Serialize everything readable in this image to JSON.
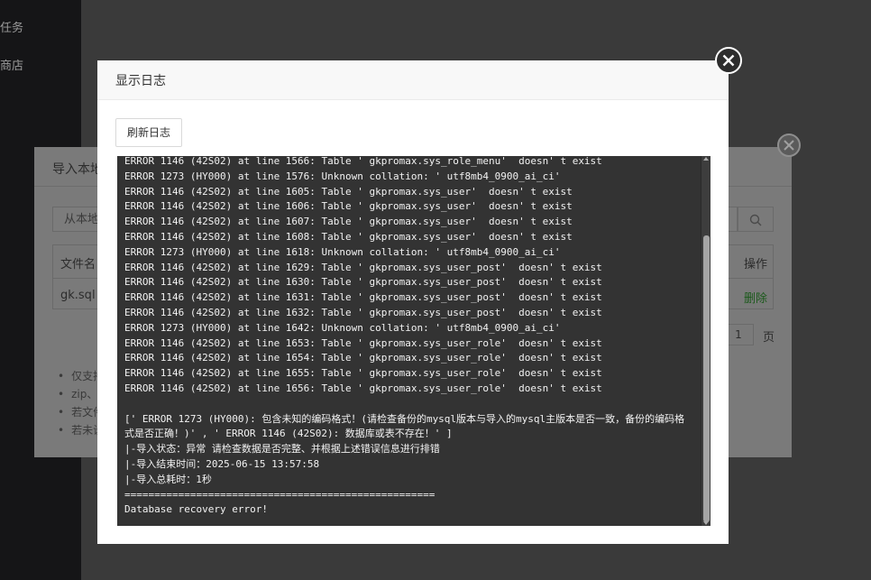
{
  "sidebar": {
    "items": [
      {
        "label": "任务"
      },
      {
        "label": "商店"
      }
    ]
  },
  "import_dialog": {
    "title": "导入本地",
    "upload_placeholder": "从本地",
    "columns": {
      "file_name": "文件名",
      "action": "操作"
    },
    "rows": [
      {
        "file_name": "gk.sql",
        "delete_label": "删除"
      }
    ],
    "page_value": "1",
    "page_unit": "页",
    "tips": [
      "仅支持",
      "zip、",
      "若文件",
      "若未设"
    ]
  },
  "log_modal": {
    "title": "显示日志",
    "refresh_label": "刷新日志",
    "lines": [
      "ERROR 1146 (42S02) at line 1566: Table ' gkpromax.sys_role_menu'  doesn' t exist",
      "ERROR 1273 (HY000) at line 1576: Unknown collation: ' utf8mb4_0900_ai_ci'",
      "ERROR 1146 (42S02) at line 1605: Table ' gkpromax.sys_user'  doesn' t exist",
      "ERROR 1146 (42S02) at line 1606: Table ' gkpromax.sys_user'  doesn' t exist",
      "ERROR 1146 (42S02) at line 1607: Table ' gkpromax.sys_user'  doesn' t exist",
      "ERROR 1146 (42S02) at line 1608: Table ' gkpromax.sys_user'  doesn' t exist",
      "ERROR 1273 (HY000) at line 1618: Unknown collation: ' utf8mb4_0900_ai_ci'",
      "ERROR 1146 (42S02) at line 1629: Table ' gkpromax.sys_user_post'  doesn' t exist",
      "ERROR 1146 (42S02) at line 1630: Table ' gkpromax.sys_user_post'  doesn' t exist",
      "ERROR 1146 (42S02) at line 1631: Table ' gkpromax.sys_user_post'  doesn' t exist",
      "ERROR 1146 (42S02) at line 1632: Table ' gkpromax.sys_user_post'  doesn' t exist",
      "ERROR 1273 (HY000) at line 1642: Unknown collation: ' utf8mb4_0900_ai_ci'",
      "ERROR 1146 (42S02) at line 1653: Table ' gkpromax.sys_user_role'  doesn' t exist",
      "ERROR 1146 (42S02) at line 1654: Table ' gkpromax.sys_user_role'  doesn' t exist",
      "ERROR 1146 (42S02) at line 1655: Table ' gkpromax.sys_user_role'  doesn' t exist",
      "ERROR 1146 (42S02) at line 1656: Table ' gkpromax.sys_user_role'  doesn' t exist",
      "",
      "[' ERROR 1273 (HY000): 包含未知的编码格式！(请检查备份的mysql版本与导入的mysql主版本是否一致，备份的编码格式是否正确！)' , ' ERROR 1146 (42S02): 数据库或表不存在！' ]",
      "|-导入状态：异常 请检查数据是否完整、并根据上述错误信息进行排错",
      "|-导入结束时间：2025-06-15 13:57:58",
      "|-导入总耗时：1秒",
      "====================================================",
      "Database recovery error!"
    ]
  }
}
